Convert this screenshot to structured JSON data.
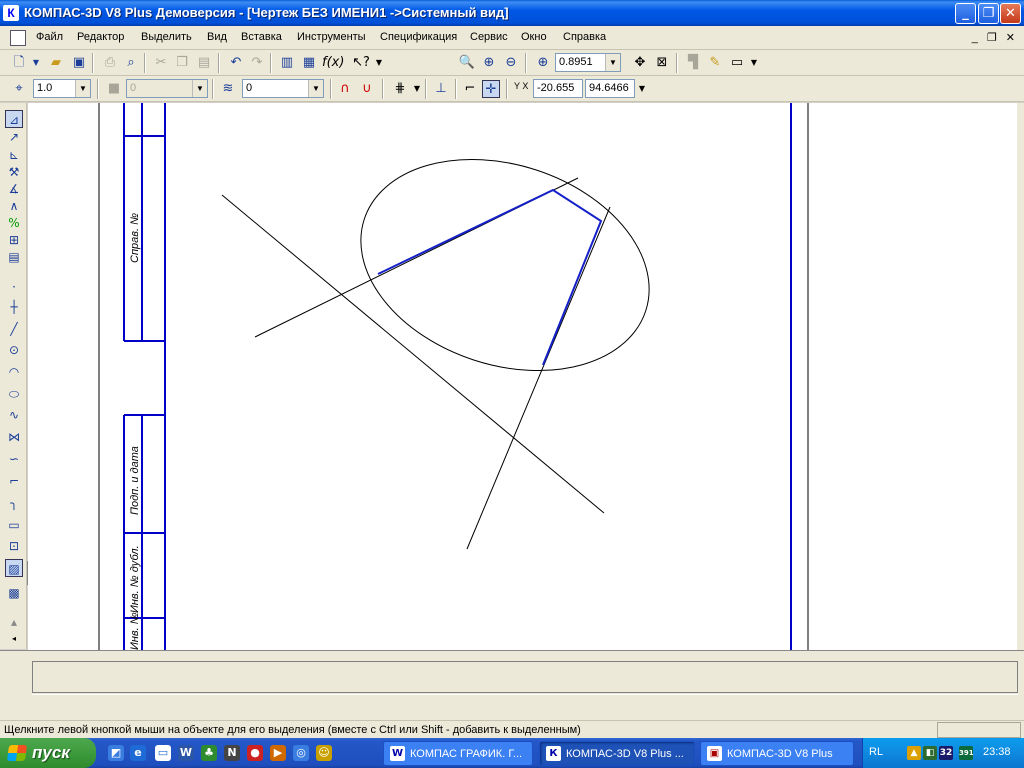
{
  "window": {
    "title": "КОМПАС-3D V8 Plus Демоверсия - [Чертеж БЕЗ ИМЕНИ1 ->Системный вид]",
    "app_icon": "К",
    "controls": {
      "minimize": "_",
      "restore": "❐",
      "close": "✕"
    }
  },
  "menu": {
    "items": [
      {
        "label": "Файл"
      },
      {
        "label": "Редактор"
      },
      {
        "label": "Выделить"
      },
      {
        "label": "Вид"
      },
      {
        "label": "Вставка"
      },
      {
        "label": "Инструменты"
      },
      {
        "label": "Спецификация"
      },
      {
        "label": "Сервис"
      },
      {
        "label": "Окно"
      },
      {
        "label": "Справка"
      }
    ],
    "mdi_controls": "_ ❐ ✕"
  },
  "toolbar1": {
    "zoom_value": "0.8951"
  },
  "toolbar2": {
    "step_value": "1.0",
    "layer_style_value": "0",
    "layer_value": "0",
    "coord_x": "-20.655",
    "coord_y": "94.6466",
    "coord_label": "Y X"
  },
  "drawing": {
    "stamp_labels": {
      "sprav_no": "Справ. №",
      "podp_data": "Подп. и дата",
      "inv_dubl": "Инв. № дубл.",
      "inv_no": "Инв. №"
    },
    "colors": {
      "frame": "#0000c8",
      "thin_line": "#000000",
      "highlight": "#1420c8"
    }
  },
  "status": {
    "text": "Щелкните левой кнопкой мыши на объекте для его выделения (вместе с Ctrl или Shift - добавить к выделенным)"
  },
  "taskbar": {
    "start_label": "пуск",
    "tasks": [
      {
        "label": "КОМПАС ГРАФИК. Г..."
      },
      {
        "label": "КОМПАС-3D V8 Plus ..."
      },
      {
        "label": "КОМПАС-3D V8  Plus"
      }
    ],
    "tray_lang": "RL",
    "clock": "23:38",
    "tray_badge": "32",
    "tray_net": "391"
  }
}
